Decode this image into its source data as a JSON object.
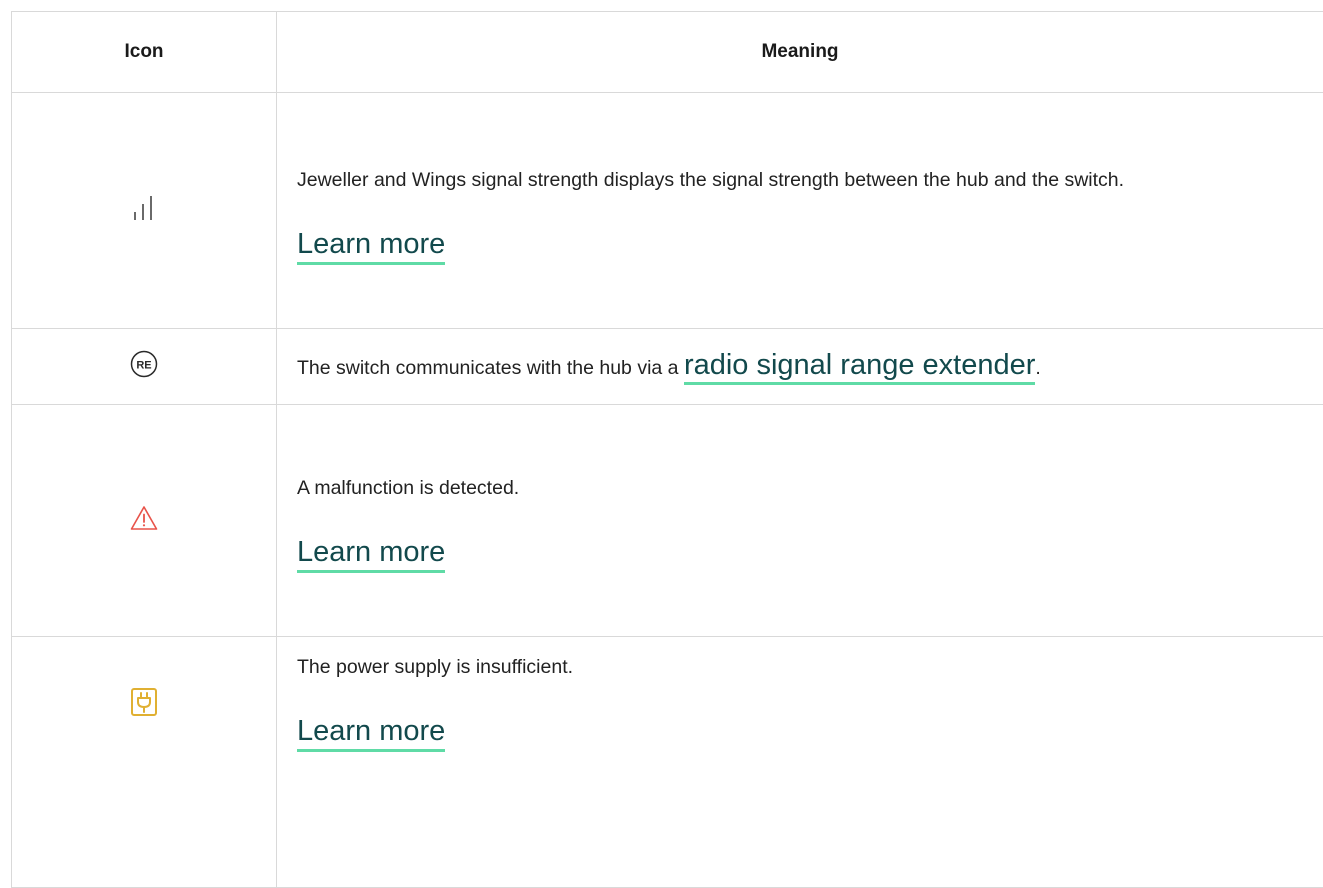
{
  "table": {
    "headers": {
      "icon": "Icon",
      "meaning": "Meaning"
    },
    "rows": [
      {
        "icon": "signal-strength-icon",
        "text": "Jeweller and Wings signal strength displays the signal strength between the hub and the switch.",
        "link": "Learn more"
      },
      {
        "icon": "range-extender-icon",
        "icon_text": "RE",
        "text_before": "The switch communicates with the hub via a ",
        "link": "radio signal range extender",
        "text_after": "."
      },
      {
        "icon": "warning-triangle-icon",
        "icon_color": "#e8534a",
        "text": "A malfunction is detected.",
        "link": "Learn more"
      },
      {
        "icon": "power-plug-icon",
        "icon_color": "#e0b032",
        "text": "The power supply is insufficient.",
        "link": "Learn more"
      }
    ]
  },
  "colors": {
    "link_text": "#12494c",
    "link_underline": "#5fdba6",
    "border": "#d9d9d9"
  }
}
